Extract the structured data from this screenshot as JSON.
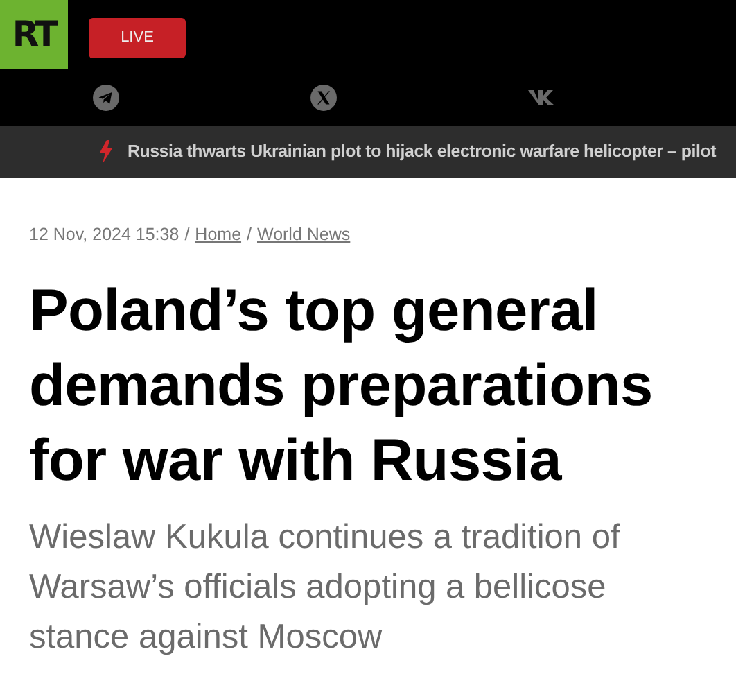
{
  "header": {
    "logo": "RT",
    "live_button": "LIVE"
  },
  "ticker": {
    "headline": "Russia thwarts Ukrainian plot to hijack electronic warfare helicopter – pilot"
  },
  "article": {
    "date": "12 Nov, 2024 15:38",
    "breadcrumbs": [
      {
        "separator": "/",
        "label": "Home"
      },
      {
        "separator": "/",
        "label": "World News"
      }
    ],
    "title": "Poland’s top general demands preparations for war with Russia",
    "summary": "Wieslaw Kukula continues a tradition of Warsaw’s officials adopting a bellicose stance against Moscow"
  }
}
